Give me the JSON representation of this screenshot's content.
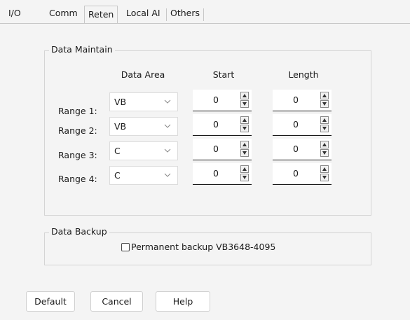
{
  "tabs": [
    {
      "label": "I/O"
    },
    {
      "label": "Comm"
    },
    {
      "label": "Reten"
    },
    {
      "label": "Local AI"
    },
    {
      "label": "Others"
    }
  ],
  "active_tab": "Reten",
  "data_maintain": {
    "title": "Data Maintain",
    "columns": {
      "area": "Data Area",
      "start": "Start",
      "length": "Length"
    },
    "rows": [
      {
        "label": "Range 1:",
        "area": "VB",
        "start": "0",
        "length": "0"
      },
      {
        "label": "Range 2:",
        "area": "VB",
        "start": "0",
        "length": "0"
      },
      {
        "label": "Range 3:",
        "area": "C",
        "start": "0",
        "length": "0"
      },
      {
        "label": "Range 4:",
        "area": "C",
        "start": "0",
        "length": "0"
      }
    ]
  },
  "data_backup": {
    "title": "Data Backup",
    "checkbox_label": "Permanent backup VB3648-4095",
    "checked": false
  },
  "buttons": {
    "default": "Default",
    "cancel": "Cancel",
    "help": "Help"
  },
  "colors": {
    "background": "#f4f4f4",
    "border": "#d4d4d4",
    "field": "#ffffff"
  }
}
